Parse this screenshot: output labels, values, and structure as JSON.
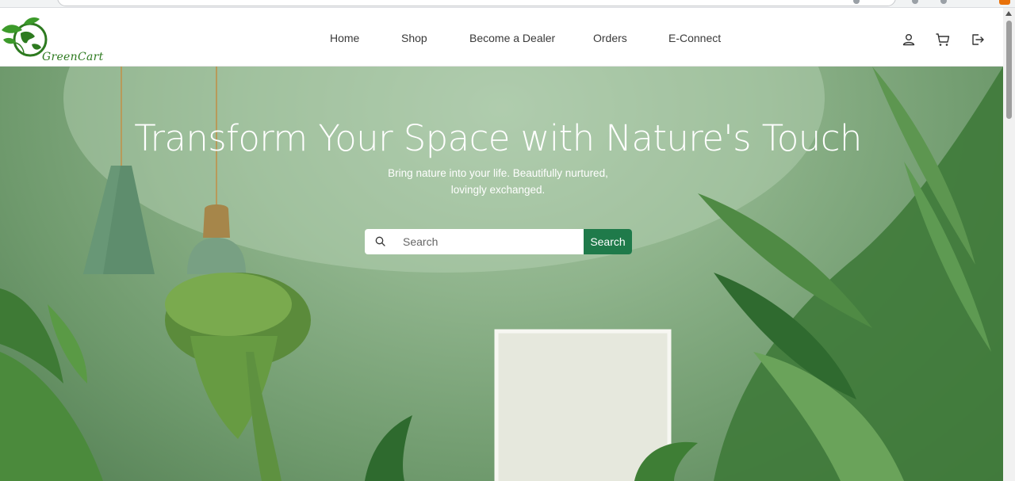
{
  "brand": {
    "name": "GreenCart",
    "color": "#2d7a1f"
  },
  "nav": {
    "links": [
      {
        "label": "Home"
      },
      {
        "label": "Shop"
      },
      {
        "label": "Become a Dealer"
      },
      {
        "label": "Orders"
      },
      {
        "label": "E-Connect"
      }
    ],
    "icons": [
      "user-icon",
      "cart-icon",
      "logout-icon"
    ]
  },
  "hero": {
    "title": "Transform Your Space with Nature's Touch",
    "subtitle_line1": "Bring nature into your life. Beautifully nurtured,",
    "subtitle_line2": "lovingly exchanged."
  },
  "search": {
    "placeholder": "Search",
    "button_label": "Search",
    "accent": "#1f7a4a"
  }
}
